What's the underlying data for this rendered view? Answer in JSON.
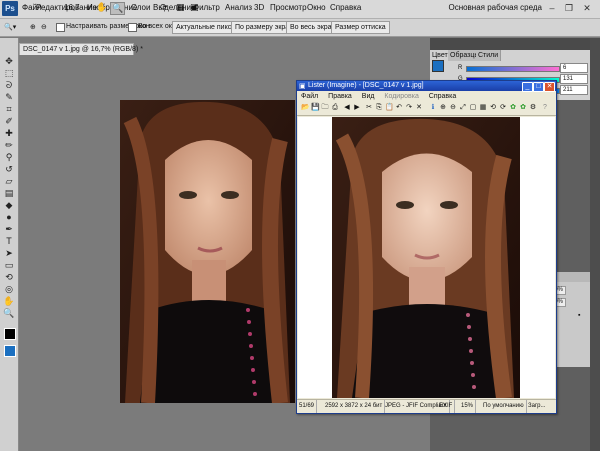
{
  "menubar": {
    "zoom": "16,7",
    "items": [
      "Файл",
      "Редактирование",
      "Изображение",
      "Слои",
      "Выделение",
      "Фильтр",
      "Анализ",
      "3D",
      "Просмотр",
      "Окно",
      "Справка"
    ],
    "workspace": "Основная рабочая среда"
  },
  "options": {
    "resize_windows": "Настраивать размер окон",
    "all_windows": "Во всех окнах",
    "buttons": [
      "Актуальные пикселы",
      "По размеру экрана",
      "Во весь экран",
      "Размер оттиска"
    ]
  },
  "document": {
    "tab": "DSC_0147 v 1.jpg @ 16,7% (RGB/8) *"
  },
  "color_panel": {
    "tabs": [
      "Цвет",
      "Образцы",
      "Стили"
    ],
    "channels": [
      "R",
      "G",
      "B"
    ],
    "values": [
      "6",
      "131",
      "211"
    ],
    "foreground": "#1b6fc0"
  },
  "layers_panel": {
    "opacity": "100%",
    "fill": "100%"
  },
  "lister": {
    "title": "Lister (Imagine) - [DSC_0147 v 1.jpg]",
    "menu": [
      "Файл",
      "Правка",
      "Вид",
      "Кодировка",
      "Справка"
    ],
    "status": {
      "index": "51/69",
      "dims": "2592 x 3872 x 24 бит",
      "format": "JPEG - JFIF Compliant",
      "exif": "EXIF",
      "zoom": "15%",
      "mode": "По умолчанию",
      "load": "Загр..."
    }
  }
}
